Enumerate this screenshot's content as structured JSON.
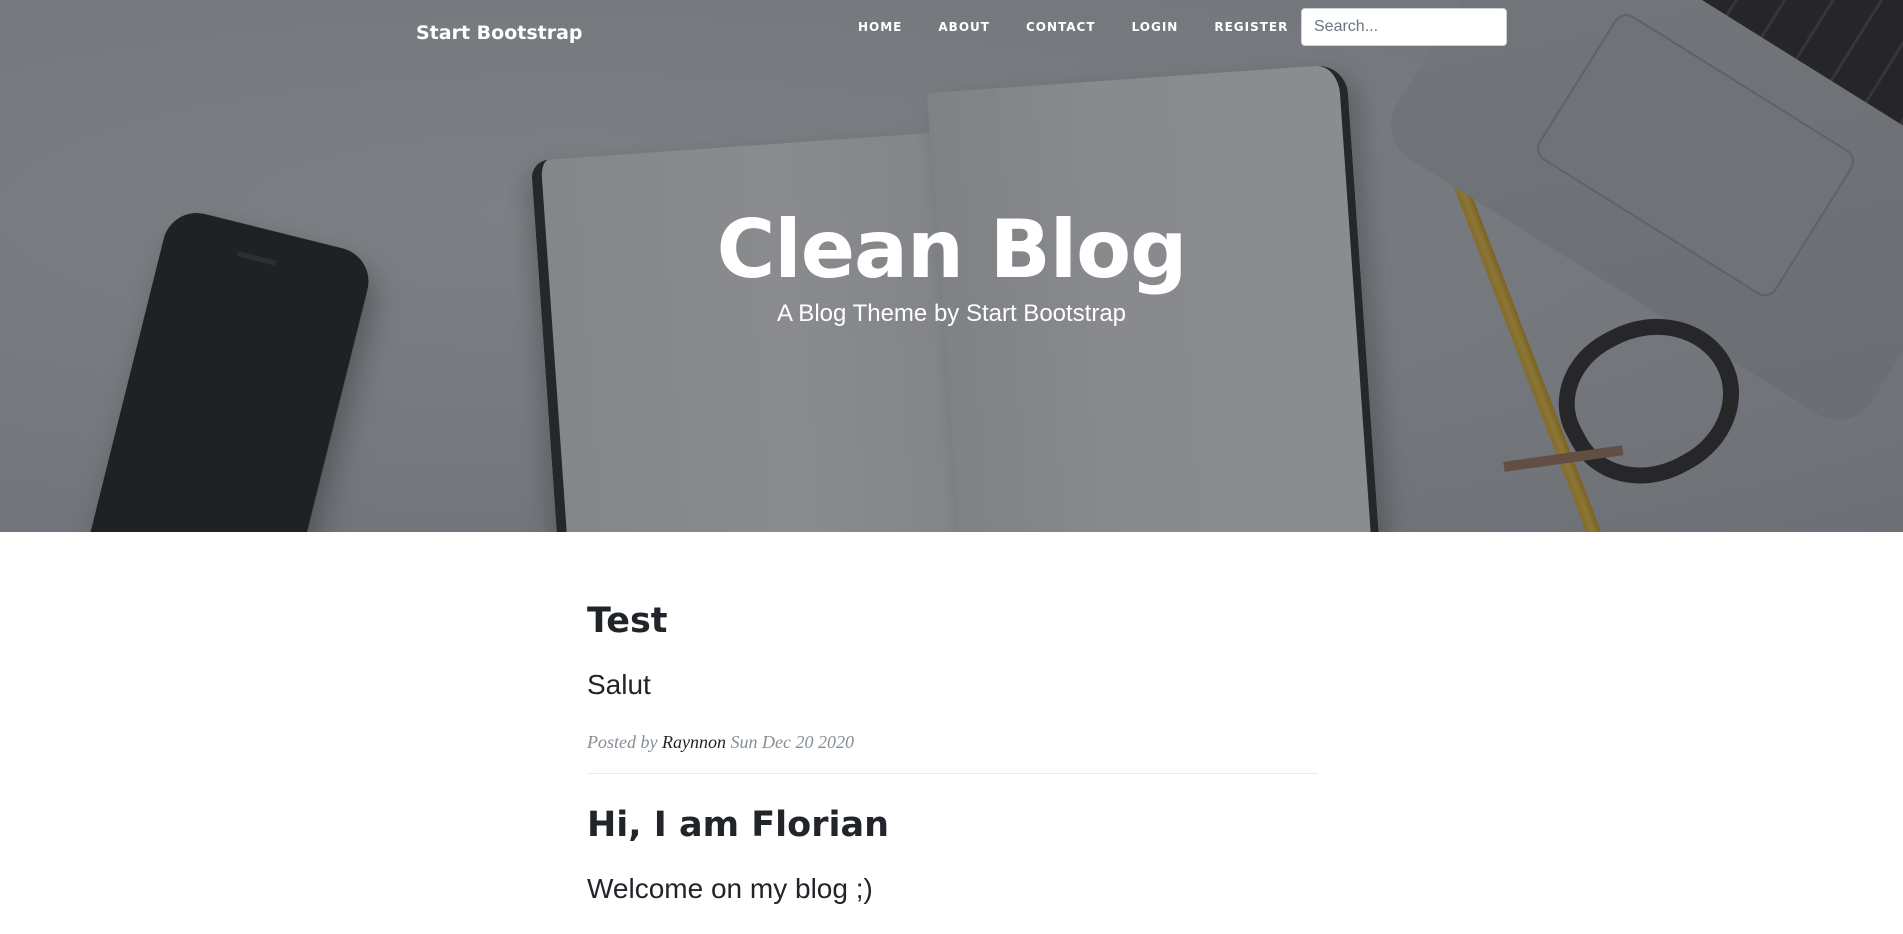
{
  "navbar": {
    "brand": "Start Bootstrap",
    "links": [
      "Home",
      "About",
      "Contact",
      "Login",
      "Register"
    ],
    "search_placeholder": "Search..."
  },
  "hero": {
    "title": "Clean Blog",
    "subtitle": "A Blog Theme by Start Bootstrap"
  },
  "posts": [
    {
      "title": "Test",
      "subtitle": "Salut",
      "posted_by": "Posted by",
      "author": "Raynnon",
      "date": "Sun Dec 20 2020"
    },
    {
      "title": "Hi, I am Florian",
      "subtitle": "Welcome on my blog ;)"
    }
  ]
}
